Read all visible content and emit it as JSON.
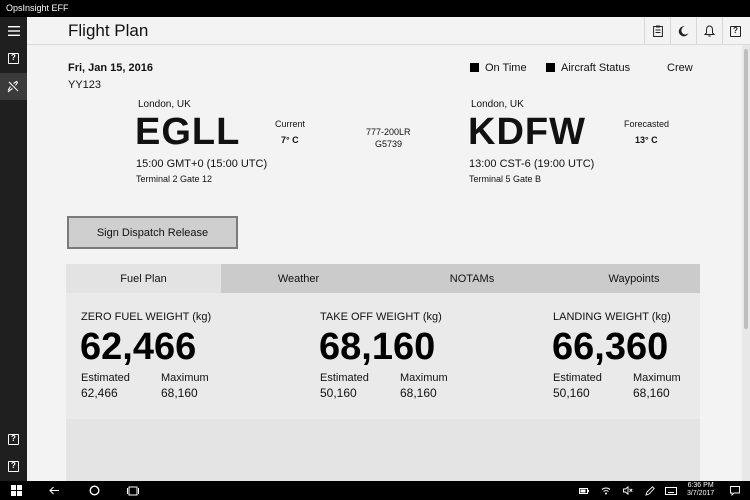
{
  "window": {
    "title": "OpsInsight EFF"
  },
  "header": {
    "page_title": "Flight Plan"
  },
  "flight": {
    "date": "Fri, Jan 15, 2016",
    "flight_number": "YY123",
    "legend": {
      "on_time": "On Time",
      "aircraft_status": "Aircraft Status",
      "crew": "Crew"
    },
    "origin": {
      "city": "London, UK",
      "code": "EGLL",
      "time": "15:00 GMT+0 (15:00 UTC)",
      "terminal": "Terminal 2 Gate 12",
      "weather_label": "Current",
      "temp": "7° C"
    },
    "aircraft": {
      "type": "777-200LR",
      "reg": "G5739"
    },
    "destination": {
      "city": "London, UK",
      "code": "KDFW",
      "time": "13:00 CST-6 (19:00 UTC)",
      "terminal": "Terminal 5 Gate B",
      "weather_label": "Forecasted",
      "temp": "13° C"
    }
  },
  "actions": {
    "sign_dispatch": "Sign Dispatch Release"
  },
  "tabs": [
    "Fuel Plan",
    "Weather",
    "NOTAMs",
    "Waypoints"
  ],
  "weights": {
    "zfw": {
      "label": "ZERO FUEL WEIGHT (kg)",
      "value": "62,466",
      "est_label": "Estimated",
      "est": "62,466",
      "max_label": "Maximum",
      "max": "68,160"
    },
    "tow": {
      "label": "TAKE OFF WEIGHT (kg)",
      "value": "68,160",
      "est_label": "Estimated",
      "est": "50,160",
      "max_label": "Maximum",
      "max": "68,160"
    },
    "lw": {
      "label": "LANDING WEIGHT (kg)",
      "value": "66,360",
      "est_label": "Estimated",
      "est": "50,160",
      "max_label": "Maximum",
      "max": "68,160"
    }
  },
  "taskbar": {
    "time": "6:36 PM",
    "date": "3/7/2017"
  }
}
